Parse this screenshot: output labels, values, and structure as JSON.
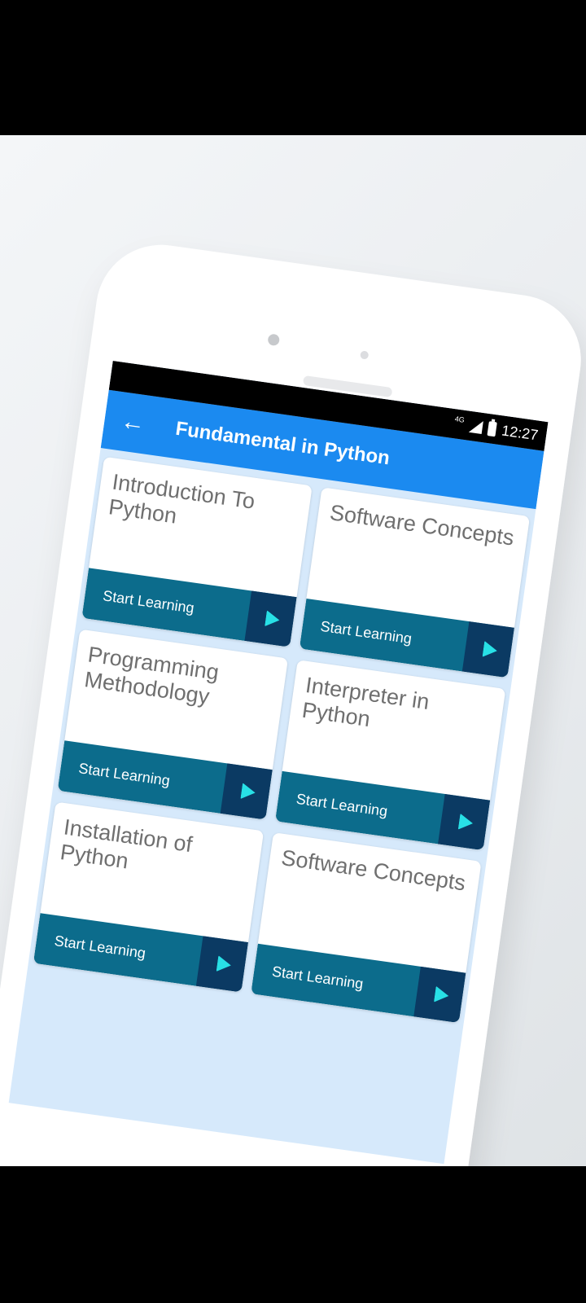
{
  "status_bar": {
    "network": "4G",
    "time": "12:27"
  },
  "app_bar": {
    "back_icon": "arrow-left-icon",
    "title": "Fundamental in Python"
  },
  "topics": [
    {
      "title": "Introduction To Python",
      "button": "Start Learning"
    },
    {
      "title": "Software Concepts",
      "button": "Start Learning"
    },
    {
      "title": "Programming Methodology",
      "button": "Start Learning"
    },
    {
      "title": "Interpreter in Python",
      "button": "Start Learning"
    },
    {
      "title": "Installation of Python",
      "button": "Start Learning"
    },
    {
      "title": "Software Concepts",
      "button": "Start Learning"
    }
  ],
  "colors": {
    "app_bar": "#1b8af0",
    "card_footer": "#0c6c8c",
    "play_box": "#0b3a63",
    "play_icon": "#28e0e6",
    "screen_background": "#d6e9fb"
  }
}
